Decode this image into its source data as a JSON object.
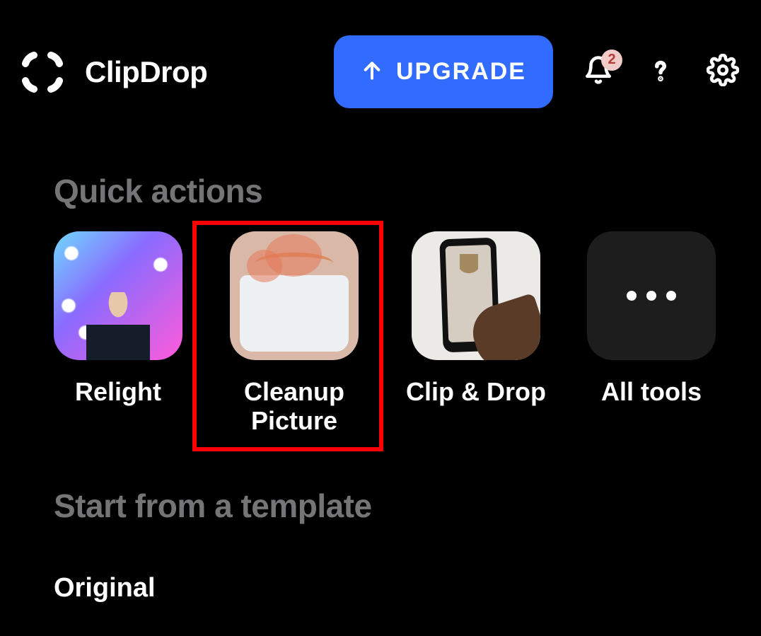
{
  "header": {
    "app_title": "ClipDrop",
    "upgrade_label": "UPGRADE",
    "notification_count": "2"
  },
  "sections": {
    "quick_actions_title": "Quick actions",
    "template_title": "Start from a template",
    "template_first_label": "Original"
  },
  "quick_actions": [
    {
      "label": "Relight"
    },
    {
      "label": "Cleanup Picture"
    },
    {
      "label": "Clip & Drop"
    },
    {
      "label": "All tools"
    }
  ],
  "highlight": {
    "index": 1
  }
}
